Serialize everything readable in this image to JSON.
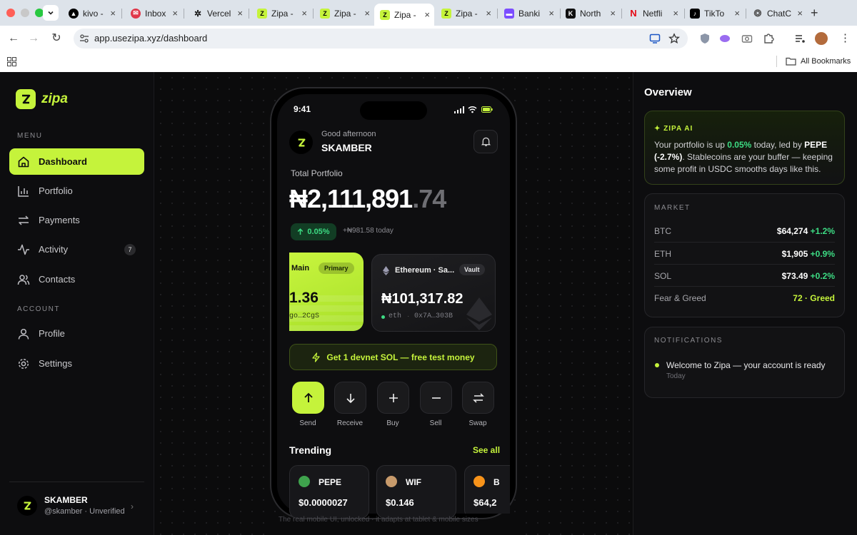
{
  "browser": {
    "tabs": [
      {
        "label": "kivo -",
        "icon": "triangle-icon"
      },
      {
        "label": "Inbox",
        "icon": "mail-icon"
      },
      {
        "label": "Vercel",
        "icon": "vercel-icon"
      },
      {
        "label": "Zipa -",
        "icon": "zipa-icon"
      },
      {
        "label": "Zipa -",
        "icon": "zipa-icon"
      },
      {
        "label": "Zipa -",
        "icon": "zipa-icon",
        "active": true
      },
      {
        "label": "Zipa -",
        "icon": "zipa-icon"
      },
      {
        "label": "Banki",
        "icon": "bank-icon"
      },
      {
        "label": "North",
        "icon": "k-icon"
      },
      {
        "label": "Netfli",
        "icon": "netflix-icon"
      },
      {
        "label": "TikTo",
        "icon": "tiktok-icon"
      },
      {
        "label": "ChatC",
        "icon": "chatgpt-icon"
      }
    ],
    "url": "app.usezipa.xyz/dashboard",
    "bookmarks_label": "All Bookmarks"
  },
  "sidebar": {
    "brand": "zipa",
    "menu_label": "MENU",
    "account_label": "ACCOUNT",
    "menu_items": [
      {
        "label": "Dashboard",
        "icon": "home-icon",
        "active": true
      },
      {
        "label": "Portfolio",
        "icon": "bar-chart-icon"
      },
      {
        "label": "Payments",
        "icon": "transfer-icon"
      },
      {
        "label": "Activity",
        "icon": "pulse-icon",
        "badge": "7"
      },
      {
        "label": "Contacts",
        "icon": "users-icon"
      }
    ],
    "account_items": [
      {
        "label": "Profile",
        "icon": "user-icon"
      },
      {
        "label": "Settings",
        "icon": "gear-icon"
      }
    ],
    "user": {
      "name": "SKAMBER",
      "sub": "@skamber · Unverified"
    }
  },
  "phone": {
    "time": "9:41",
    "greeting": "Good afternoon",
    "name": "SKAMBER",
    "portfolio_label": "Total Portfolio",
    "portfolio_whole": "₦2,111,891",
    "portfolio_decimal": ".74",
    "change_pct": "0.05%",
    "change_today": "+₦981.58 today",
    "card_main": {
      "label": "Main",
      "tag": "Primary",
      "amount": "1.36",
      "address": "go…2CgS"
    },
    "card_eth": {
      "label": "Ethereum · Sa...",
      "tag": "Vault",
      "amount": "₦101,317.82",
      "network": "eth",
      "address": "0x7A…303B"
    },
    "faucet": "Get 1 devnet SOL — free test money",
    "actions": [
      "Send",
      "Receive",
      "Buy",
      "Sell",
      "Swap"
    ],
    "trending_title": "Trending",
    "see_all": "See all",
    "trending": [
      {
        "symbol": "PEPE",
        "price": "$0.0000027",
        "color": "#3fa34d"
      },
      {
        "symbol": "WIF",
        "price": "$0.146",
        "color": "#c79a6b"
      },
      {
        "symbol": "B",
        "price": "$64,2",
        "color": "#f7931a"
      }
    ],
    "caption": "The real mobile UI, unlocked · it adapts at tablet & mobile sizes"
  },
  "overview": {
    "title": "Overview",
    "ai_label": "✦ ZIPA AI",
    "ai_text_1": "Your portfolio is up ",
    "ai_pct": "0.05%",
    "ai_text_2": " today, led by ",
    "ai_lead": "PEPE (-2.7%)",
    "ai_text_3": ". Stablecoins are your buffer — keeping some profit in USDC smooths days like this.",
    "market_label": "MARKET",
    "market": [
      {
        "name": "BTC",
        "price": "$64,274",
        "change": "+1.2%"
      },
      {
        "name": "ETH",
        "price": "$1,905",
        "change": "+0.9%"
      },
      {
        "name": "SOL",
        "price": "$73.49",
        "change": "+0.2%"
      }
    ],
    "fear_label": "Fear & Greed",
    "fear_value": "72 · Greed",
    "notifications_label": "NOTIFICATIONS",
    "notification": {
      "text": "Welcome to Zipa — your account is ready",
      "time": "Today"
    }
  },
  "colors": {
    "accent": "#c5f33b",
    "positive": "#3ddc84",
    "background": "#0b0b0c"
  }
}
